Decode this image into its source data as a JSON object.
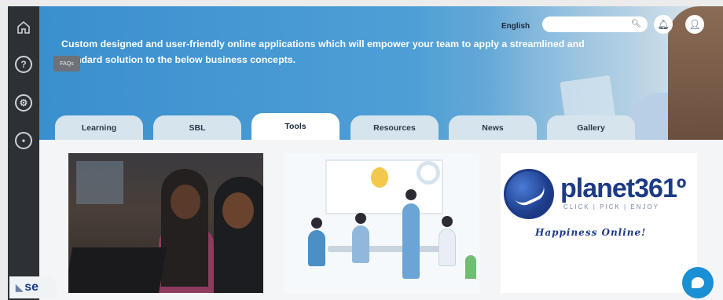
{
  "header": {
    "headline": "Custom designed and user-friendly online applications which will empower your team to apply a streamlined and standard solution to the below business concepts.",
    "language": "English",
    "search_placeholder": ""
  },
  "sidebar": {
    "tooltip": "FAQs",
    "items": [
      {
        "name": "home"
      },
      {
        "name": "faq"
      },
      {
        "name": "settings"
      },
      {
        "name": "info"
      }
    ]
  },
  "tabs": [
    {
      "label": "Learning",
      "active": false
    },
    {
      "label": "SBL",
      "active": false
    },
    {
      "label": "Tools",
      "active": true
    },
    {
      "label": "Resources",
      "active": false
    },
    {
      "label": "News",
      "active": false
    },
    {
      "label": "Gallery",
      "active": false
    }
  ],
  "cards": {
    "planet": {
      "brand": "planet",
      "brand_num": "361º",
      "tagline": "CLICK | PICK | ENJOY",
      "slogan": "Happiness Online!"
    }
  },
  "footer": {
    "logo_text": "se"
  },
  "colors": {
    "rail": "#2d3136",
    "banner": "#3a8fce",
    "brand_blue": "#1d3a86",
    "chat": "#1a8fd3"
  }
}
